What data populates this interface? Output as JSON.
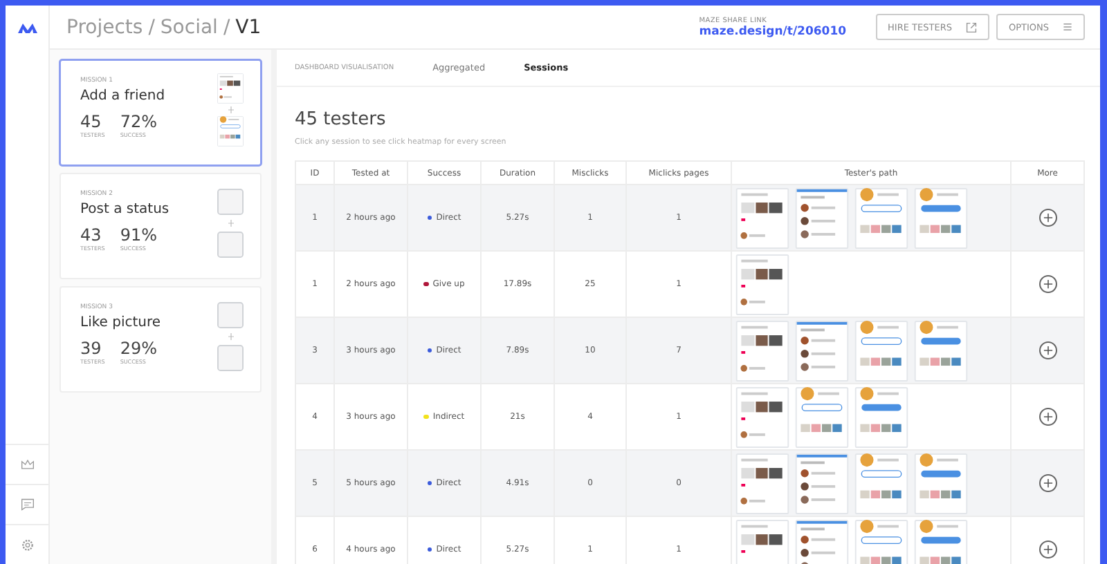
{
  "breadcrumb": {
    "parts": [
      "Projects",
      "Social"
    ],
    "current": "V1",
    "separator": "/"
  },
  "share": {
    "label": "MAZE SHARE LINK",
    "link": "maze.design/t/206010"
  },
  "buttons": [
    {
      "label": "HIRE TESTERS",
      "kind": "external"
    },
    {
      "label": "OPTIONS",
      "kind": "list"
    }
  ],
  "missions": [
    {
      "label": "MISSION 1",
      "title": "Add a friend",
      "testers": "45",
      "testers_label": "TESTERS",
      "success": "72%",
      "success_label": "SUCCESS",
      "selected": true,
      "screens": [
        {
          "kind": "feed"
        },
        {
          "kind": "profile"
        }
      ]
    },
    {
      "label": "MISSION 2",
      "title": "Post a status",
      "testers": "43",
      "testers_label": "TESTERS",
      "success": "91%",
      "success_label": "SUCCESS",
      "selected": false,
      "screens": [
        {
          "kind": "empty"
        },
        {
          "kind": "empty"
        }
      ]
    },
    {
      "label": "MISSION 3",
      "title": "Like picture",
      "testers": "39",
      "testers_label": "TESTERS",
      "success": "29%",
      "success_label": "SUCCESS",
      "selected": false,
      "screens": [
        {
          "kind": "empty"
        },
        {
          "kind": "empty"
        }
      ]
    }
  ],
  "view_label": "DASHBOARD VISUALISATION",
  "tabs": [
    {
      "label": "Aggregated",
      "selected": false
    },
    {
      "label": "Sessions",
      "selected": true
    }
  ],
  "heading": "45 testers",
  "subtitle": "Click any session to see click heatmap for every screen",
  "table": {
    "columns": [
      "ID",
      "Tested at",
      "Success",
      "Duration",
      "Misclicks",
      "Miclicks pages",
      "Tester's path",
      "More"
    ],
    "rows": [
      {
        "id": "1",
        "tested_at": "2 hours ago",
        "success": "Direct",
        "color": "#3b5bdb",
        "duration": "5.27s",
        "misclicks": "1",
        "misclick_pages": "1",
        "path": [
          {
            "kind": "feed"
          },
          {
            "kind": "friends"
          },
          {
            "kind": "profile"
          },
          {
            "kind": "followed"
          }
        ]
      },
      {
        "id": "1",
        "tested_at": "2 hours ago",
        "success": "Give up",
        "color": "#b0173a",
        "duration": "17.89s",
        "misclicks": "25",
        "misclick_pages": "1",
        "path": [
          {
            "kind": "feed"
          }
        ]
      },
      {
        "id": "3",
        "tested_at": "3 hours ago",
        "success": "Direct",
        "color": "#3b5bdb",
        "duration": "7.89s",
        "misclicks": "10",
        "misclick_pages": "7",
        "path": [
          {
            "kind": "feed"
          },
          {
            "kind": "friends"
          },
          {
            "kind": "profile"
          },
          {
            "kind": "followed"
          }
        ]
      },
      {
        "id": "4",
        "tested_at": "3 hours ago",
        "success": "Indirect",
        "color": "#f2e21c",
        "duration": "21s",
        "misclicks": "4",
        "misclick_pages": "1",
        "path": [
          {
            "kind": "feed"
          },
          {
            "kind": "profile"
          },
          {
            "kind": "followed"
          }
        ]
      },
      {
        "id": "5",
        "tested_at": "5 hours ago",
        "success": "Direct",
        "color": "#3b5bdb",
        "duration": "4.91s",
        "misclicks": "0",
        "misclick_pages": "0",
        "path": [
          {
            "kind": "feed"
          },
          {
            "kind": "friends"
          },
          {
            "kind": "profile"
          },
          {
            "kind": "followed"
          }
        ]
      },
      {
        "id": "6",
        "tested_at": "4 hours ago",
        "success": "Direct",
        "color": "#3b5bdb",
        "duration": "5.27s",
        "misclicks": "1",
        "misclick_pages": "1",
        "path": [
          {
            "kind": "feed"
          },
          {
            "kind": "friends"
          },
          {
            "kind": "profile"
          },
          {
            "kind": "followed"
          }
        ]
      }
    ]
  }
}
